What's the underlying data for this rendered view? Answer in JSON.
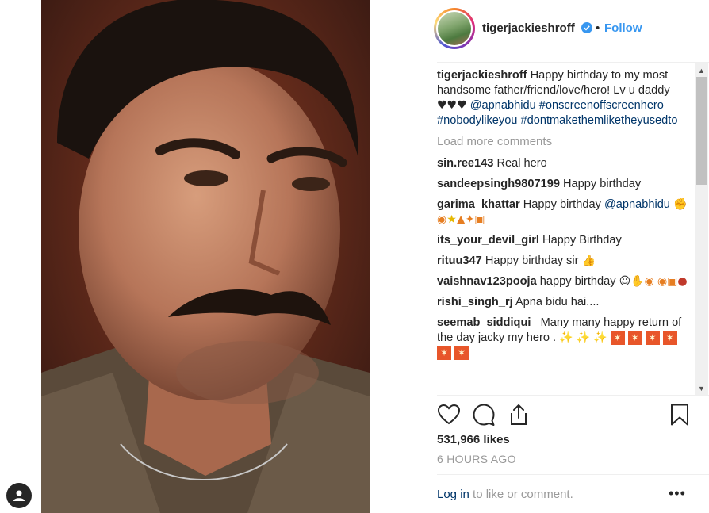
{
  "post": {
    "username": "tigerjackieshroff",
    "follow_label": "Follow",
    "separator": "•",
    "caption_text": "Happy birthday to my most handsome father/friend/love/hero! Lv u daddy",
    "caption_hearts": "♥♥♥",
    "caption_mention": "@apnabhidu",
    "caption_tags": [
      "#onscreenoffscreenhero",
      "#nobodylikeyou",
      "#dontmakethemliketheyusedto"
    ],
    "load_more_label": "Load more comments",
    "likes": "531,966 likes",
    "time": "6 HOURS AGO",
    "login_link": "Log in",
    "login_rest": "to like or comment.",
    "more_label": "•••"
  },
  "comments": [
    {
      "user": "sin.ree143",
      "text": "Real hero"
    },
    {
      "user": "sandeepsingh9807199",
      "text": "Happy birthday"
    },
    {
      "user": "garima_khattar",
      "text": "Happy birthday",
      "mention": "@apnabhidu"
    },
    {
      "user": "its_your_devil_girl",
      "text": "Happy Birthday"
    },
    {
      "user": "rituu347",
      "text": "Happy birthday sir"
    },
    {
      "user": "vaishnav123pooja",
      "text": "happy birthday"
    },
    {
      "user": "rishi_singh_rj",
      "text": "Apna bidu hai...."
    },
    {
      "user": "seemab_siddiqui_",
      "text": "Many many happy return of the day jacky my hero ."
    }
  ],
  "icons": {
    "verified": "verified-badge-icon",
    "like": "heart-icon",
    "comment": "comment-bubble-icon",
    "share": "share-icon",
    "save": "bookmark-icon",
    "profile": "user-icon"
  },
  "colors": {
    "link_blue": "#3897f0",
    "tag_blue": "#003569",
    "muted": "#999999",
    "text": "#262626"
  }
}
